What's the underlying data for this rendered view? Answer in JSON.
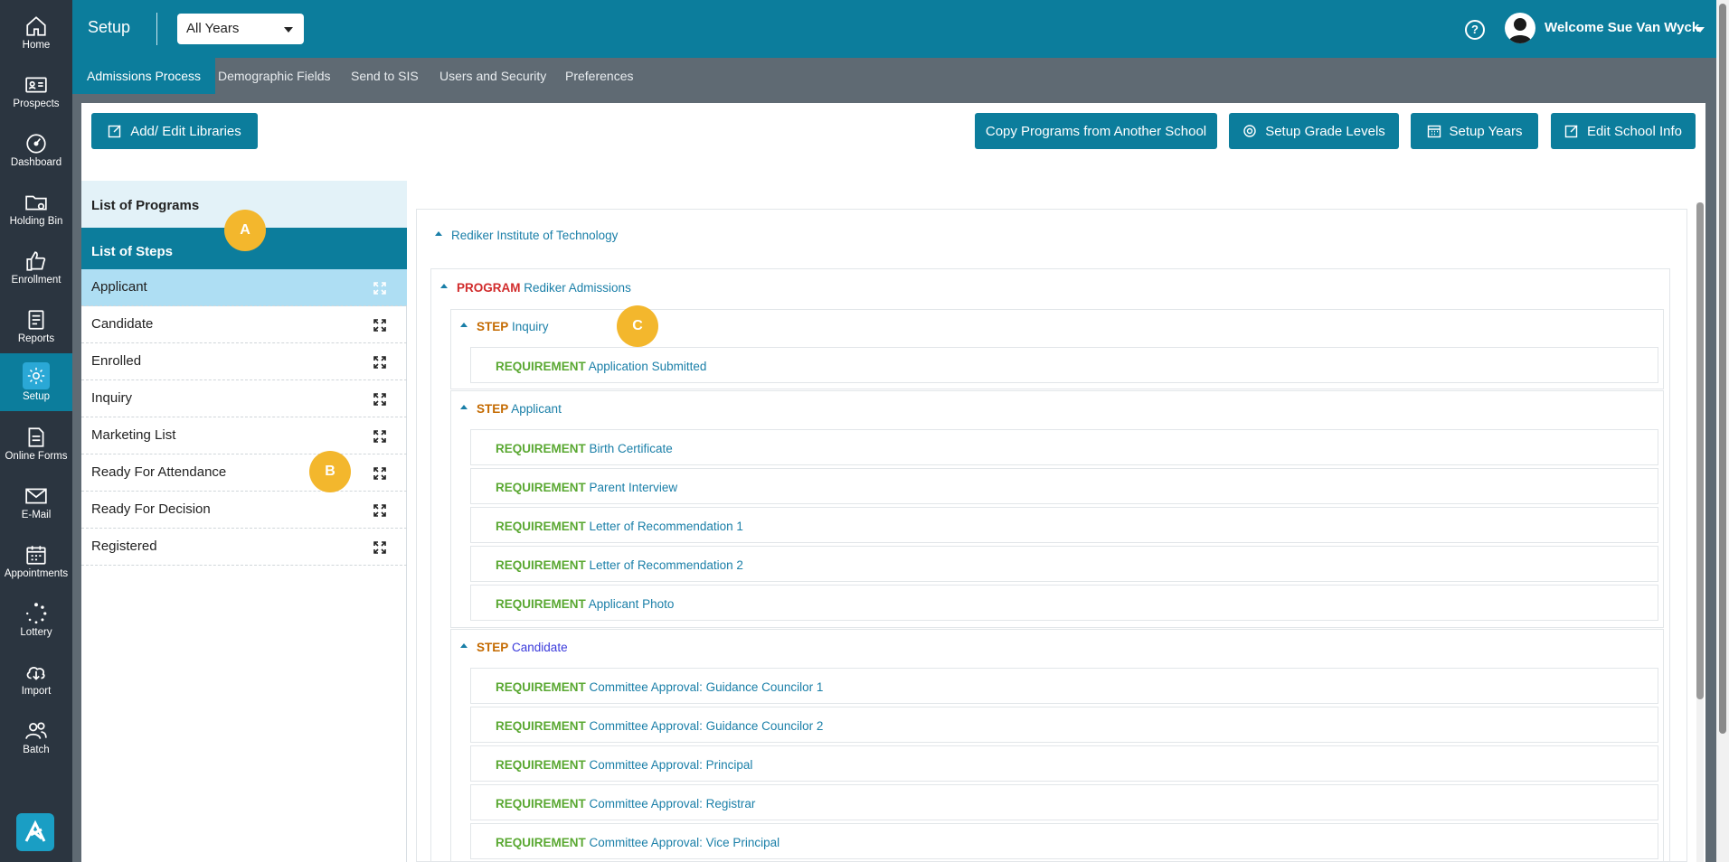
{
  "sidebar": {
    "items": [
      {
        "label": "Home",
        "icon": "home-icon"
      },
      {
        "label": "Prospects",
        "icon": "id-card-icon"
      },
      {
        "label": "Dashboard",
        "icon": "dashboard-icon"
      },
      {
        "label": "Holding Bin",
        "icon": "folder-icon"
      },
      {
        "label": "Enrollment",
        "icon": "thumbs-up-icon"
      },
      {
        "label": "Reports",
        "icon": "report-icon"
      },
      {
        "label": "Setup",
        "icon": "gear-icon"
      },
      {
        "label": "Online Forms",
        "icon": "form-icon"
      },
      {
        "label": "E-Mail",
        "icon": "mail-icon"
      },
      {
        "label": "Appointments",
        "icon": "calendar-icon"
      },
      {
        "label": "Lottery",
        "icon": "spinner-icon"
      },
      {
        "label": "Import",
        "icon": "cloud-download-icon"
      },
      {
        "label": "Batch",
        "icon": "users-icon"
      }
    ],
    "active": "Setup"
  },
  "header": {
    "title": "Setup",
    "year_select": "All Years",
    "welcome": "Welcome Sue Van Wyck"
  },
  "tabs": [
    "Admissions Process",
    "Demographic Fields",
    "Send to SIS",
    "Users and Security",
    "Preferences"
  ],
  "active_tab": "Admissions Process",
  "toolbar": {
    "add_edit_libraries": "Add/ Edit Libraries",
    "copy_programs": "Copy Programs from Another School",
    "setup_grade_levels": "Setup Grade Levels",
    "setup_years": "Setup Years",
    "edit_school_info": "Edit School Info"
  },
  "left_panel": {
    "programs_header": "List of Programs",
    "steps_header": "List of Steps",
    "steps": [
      "Applicant",
      "Candidate",
      "Enrolled",
      "Inquiry",
      "Marketing List",
      "Ready For Attendance",
      "Ready For Decision",
      "Registered"
    ],
    "selected_step": "Applicant"
  },
  "tree": {
    "school": "Rediker Institute of Technology",
    "program_kw": "PROGRAM",
    "program": "Rediker Admissions",
    "step_kw": "STEP",
    "req_kw": "REQUIREMENT",
    "steps": [
      {
        "name": "Inquiry",
        "requirements": [
          "Application Submitted"
        ]
      },
      {
        "name": "Applicant",
        "requirements": [
          "Birth Certificate",
          "Parent Interview",
          "Letter of Recommendation 1",
          "Letter of Recommendation 2",
          "Applicant Photo"
        ]
      },
      {
        "name": "Candidate",
        "requirements": [
          "Committee Approval: Guidance Councilor 1",
          "Committee Approval: Guidance Councilor 2",
          "Committee Approval: Principal",
          "Committee Approval: Registrar",
          "Committee Approval: Vice Principal"
        ]
      }
    ]
  },
  "markers": [
    "A",
    "B",
    "C"
  ],
  "colors": {
    "primary": "#0c7d9c",
    "sidebar": "#2b3540",
    "marker": "#f3b72d",
    "program_kw": "#d12b2b",
    "step_kw": "#c46a00",
    "req_kw": "#5aa832"
  }
}
